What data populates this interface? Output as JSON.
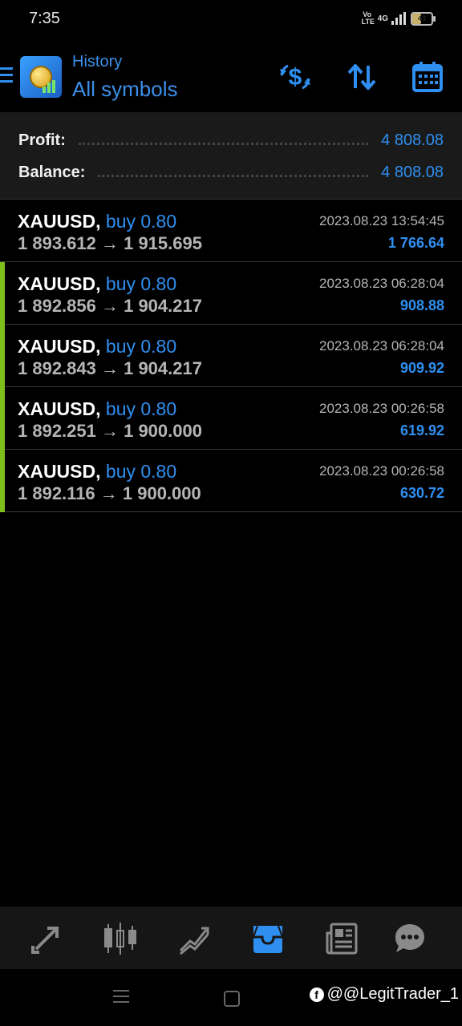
{
  "status_bar": {
    "time": "7:35",
    "volte_label": "Vo LTE",
    "network": "4G",
    "battery": "43"
  },
  "header": {
    "title": "History",
    "subtitle": "All symbols",
    "icons": [
      "menu-icon",
      "currency-exchange-icon",
      "sort-icon",
      "calendar-icon"
    ]
  },
  "summary": {
    "profit_label": "Profit:",
    "profit_value": "4 808.08",
    "balance_label": "Balance:",
    "balance_value": "4 808.08"
  },
  "deals": [
    {
      "symbol": "XAUUSD,",
      "side": "buy 0.80",
      "prices": "1 893.612 → 1 915.695",
      "time": "2023.08.23 13:54:45",
      "profit": "1 766.64",
      "accent": false
    },
    {
      "symbol": "XAUUSD,",
      "side": "buy 0.80",
      "prices": "1 892.856 → 1 904.217",
      "time": "2023.08.23 06:28:04",
      "profit": "908.88",
      "accent": true
    },
    {
      "symbol": "XAUUSD,",
      "side": "buy 0.80",
      "prices": "1 892.843 → 1 904.217",
      "time": "2023.08.23 06:28:04",
      "profit": "909.92",
      "accent": true
    },
    {
      "symbol": "XAUUSD,",
      "side": "buy 0.80",
      "prices": "1 892.251 → 1 900.000",
      "time": "2023.08.23 00:26:58",
      "profit": "619.92",
      "accent": true
    },
    {
      "symbol": "XAUUSD,",
      "side": "buy 0.80",
      "prices": "1 892.116 → 1 900.000",
      "time": "2023.08.23 00:26:58",
      "profit": "630.72",
      "accent": true
    }
  ],
  "bottom_nav": {
    "items": [
      "quotes-icon",
      "chart-icon",
      "trade-icon",
      "history-icon",
      "news-icon",
      "chat-icon"
    ],
    "active": "history-icon"
  },
  "watermark": {
    "text": "@@LegitTrader_1",
    "fb_glyph": "f"
  },
  "colors": {
    "accent_blue": "#2f8ff0",
    "profit_bar_green": "#7fbf1c",
    "background": "#000000",
    "summary_bg": "#1a1a1a",
    "nav_bg": "#161616"
  }
}
